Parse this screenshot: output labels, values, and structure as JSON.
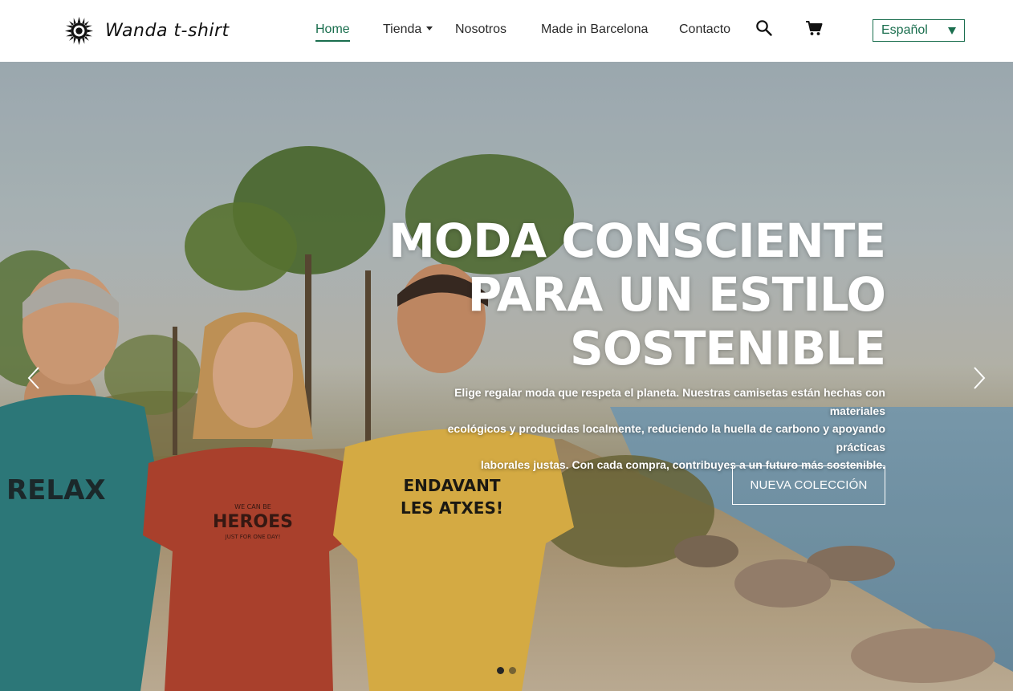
{
  "brand": {
    "name": "Wanda t-shirt",
    "logo_icon": "sun-icon"
  },
  "nav": {
    "items": [
      {
        "label": "Home",
        "active": true
      },
      {
        "label": "Tienda",
        "has_dropdown": true
      },
      {
        "label": "Nosotros"
      },
      {
        "label": "Made in Barcelona"
      },
      {
        "label": "Contacto"
      }
    ],
    "search_icon": "search-icon",
    "cart_icon": "cart-icon"
  },
  "language": {
    "selected": "Español"
  },
  "hero": {
    "title_lines": [
      "MODA CONSCIENTE",
      "PARA UN ESTILO",
      "SOSTENIBLE"
    ],
    "subtitle_lines": [
      "Elige regalar moda que respeta el planeta. Nuestras camisetas están hechas con materiales",
      "ecológicos y producidas localmente, reduciendo la huella de carbono y apoyando prácticas",
      "laborales justas. Con cada compra, contribuyes a un futuro más sostenible."
    ],
    "cta_label": "NUEVA COLECCIÓN",
    "slides_total": 2,
    "active_slide": 1,
    "tshirt_prints": [
      {
        "text": "RELAX"
      },
      {
        "lines": [
          "WE CAN BE",
          "HEROES",
          "JUST FOR ONE DAY!"
        ]
      },
      {
        "lines": [
          "ENDAVANT",
          "LES ATXES!"
        ]
      }
    ]
  },
  "colors": {
    "accent": "#1a6e4e",
    "white": "#ffffff",
    "text": "#2b2b2b"
  }
}
